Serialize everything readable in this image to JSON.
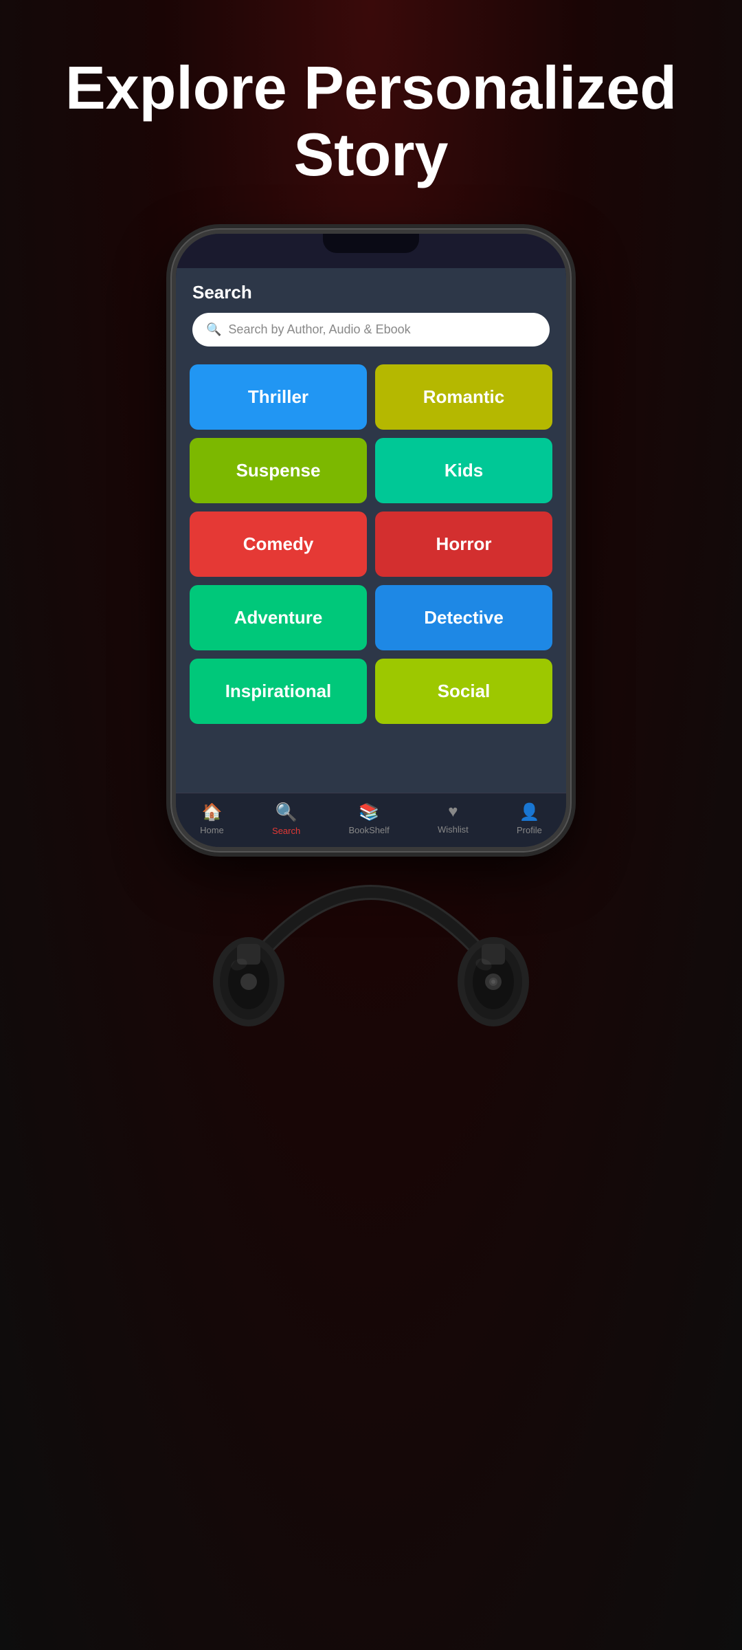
{
  "headline": {
    "line1": "Explore Personalized",
    "line2": "Story"
  },
  "phone": {
    "screen_title": "Search",
    "search_placeholder": "Search by Author, Audio & Ebook",
    "genres": [
      {
        "id": "thriller",
        "label": "Thriller",
        "color_class": "genre-thriller"
      },
      {
        "id": "romantic",
        "label": "Romantic",
        "color_class": "genre-romantic"
      },
      {
        "id": "suspense",
        "label": "Suspense",
        "color_class": "genre-suspense"
      },
      {
        "id": "kids",
        "label": "Kids",
        "color_class": "genre-kids"
      },
      {
        "id": "comedy",
        "label": "Comedy",
        "color_class": "genre-comedy"
      },
      {
        "id": "horror",
        "label": "Horror",
        "color_class": "genre-horror"
      },
      {
        "id": "adventure",
        "label": "Adventure",
        "color_class": "genre-adventure"
      },
      {
        "id": "detective",
        "label": "Detective",
        "color_class": "genre-detective"
      },
      {
        "id": "inspirational",
        "label": "Inspirational",
        "color_class": "genre-inspirational"
      },
      {
        "id": "social",
        "label": "Social",
        "color_class": "genre-social"
      }
    ],
    "nav": [
      {
        "id": "home",
        "label": "Home",
        "icon": "🏠",
        "active": false
      },
      {
        "id": "search",
        "label": "Search",
        "icon": "🔍",
        "active": true
      },
      {
        "id": "bookshelf",
        "label": "BookShelf",
        "icon": "📚",
        "active": false
      },
      {
        "id": "wishlist",
        "label": "Wishlist",
        "icon": "♥",
        "active": false
      },
      {
        "id": "profile",
        "label": "Profile",
        "icon": "👤",
        "active": false
      }
    ]
  }
}
